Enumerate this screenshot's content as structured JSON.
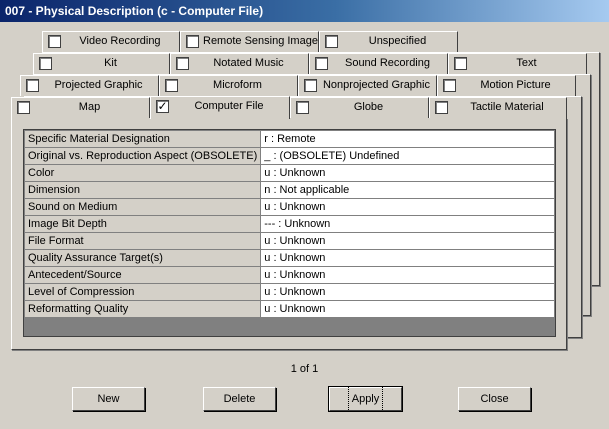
{
  "window": {
    "title": "007 - Physical Description (c - Computer File)"
  },
  "tabs": {
    "row1": [
      {
        "label": "Video Recording",
        "checked": false
      },
      {
        "label": "Remote Sensing Image",
        "checked": false
      },
      {
        "label": "Unspecified",
        "checked": false
      }
    ],
    "row2": [
      {
        "label": "Kit",
        "checked": false
      },
      {
        "label": "Notated Music",
        "checked": false
      },
      {
        "label": "Sound Recording",
        "checked": false
      },
      {
        "label": "Text",
        "checked": false
      }
    ],
    "row3": [
      {
        "label": "Projected Graphic",
        "checked": false
      },
      {
        "label": "Microform",
        "checked": false
      },
      {
        "label": "Nonprojected Graphic",
        "checked": false
      },
      {
        "label": "Motion Picture",
        "checked": false
      }
    ],
    "row4": [
      {
        "label": "Map",
        "checked": false
      },
      {
        "label": "Computer File",
        "checked": true
      },
      {
        "label": "Globe",
        "checked": false
      },
      {
        "label": "Tactile Material",
        "checked": false
      }
    ]
  },
  "grid": {
    "rows": [
      {
        "field": "Specific Material Designation",
        "value": "r : Remote"
      },
      {
        "field": "Original vs. Reproduction Aspect (OBSOLETE)",
        "value": "_ : (OBSOLETE) Undefined"
      },
      {
        "field": "Color",
        "value": "u : Unknown"
      },
      {
        "field": "Dimension",
        "value": "n : Not applicable"
      },
      {
        "field": "Sound on Medium",
        "value": "u : Unknown"
      },
      {
        "field": "Image Bit Depth",
        "value": "--- : Unknown"
      },
      {
        "field": "File Format",
        "value": "u : Unknown"
      },
      {
        "field": "Quality Assurance Target(s)",
        "value": "u : Unknown"
      },
      {
        "field": "Antecedent/Source",
        "value": "u : Unknown"
      },
      {
        "field": "Level of Compression",
        "value": "u : Unknown"
      },
      {
        "field": "Reformatting Quality",
        "value": "u : Unknown"
      }
    ]
  },
  "pager": {
    "text": "1 of 1"
  },
  "buttons": {
    "new": "New",
    "delete": "Delete",
    "apply": "Apply",
    "close": "Close"
  },
  "checkmark": "✓"
}
